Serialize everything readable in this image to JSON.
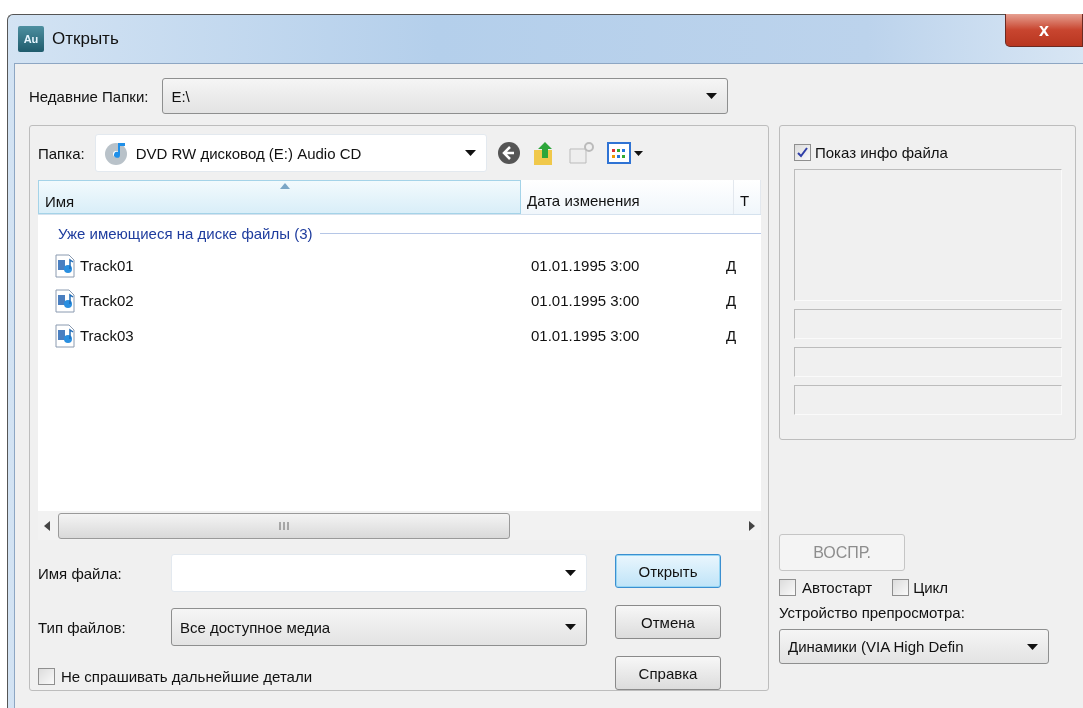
{
  "window": {
    "title": "Открыть",
    "app_icon": "Au",
    "close": "x"
  },
  "recent_folders": {
    "label": "Недавние Папки:",
    "value": "E:\\"
  },
  "folder": {
    "label": "Папка:",
    "value": "DVD RW дисковод (E:) Audio CD"
  },
  "file_list": {
    "columns": [
      {
        "label": "Имя",
        "sorted": true
      },
      {
        "label": "Дата изменения",
        "sorted": false
      },
      {
        "label": "Т",
        "sorted": false
      }
    ],
    "group": "Уже имеющиеся на диске файлы (3)",
    "rows": [
      {
        "name": "Track01",
        "date": "01.01.1995 3:00",
        "column_3": "Д"
      },
      {
        "name": "Track02",
        "date": "01.01.1995 3:00",
        "column_3": "Д"
      },
      {
        "name": "Track03",
        "date": "01.01.1995 3:00",
        "column_3": "Д"
      }
    ]
  },
  "file_name": {
    "label": "Имя файла:"
  },
  "file_type": {
    "label": "Тип файлов:",
    "value": "Все доступное медиа"
  },
  "dont_ask": {
    "label": "Не спрашивать дальнейшие детали",
    "checked": false
  },
  "buttons": [
    {
      "label": "Открыть",
      "default": true
    },
    {
      "label": "Отмена",
      "default": false
    },
    {
      "label": "Справка",
      "default": false
    }
  ],
  "preview": {
    "show_info": {
      "label": "Показ инфо файла",
      "checked": true
    },
    "play_button": {
      "label": "ВОСПР.",
      "disabled": true
    },
    "autostart": {
      "label": "Автостарт",
      "checked": false
    },
    "loop": {
      "label": "Цикл",
      "checked": false
    },
    "device_label": "Устройство препросмотра:",
    "device": "Динамики (VIA High Defin"
  }
}
